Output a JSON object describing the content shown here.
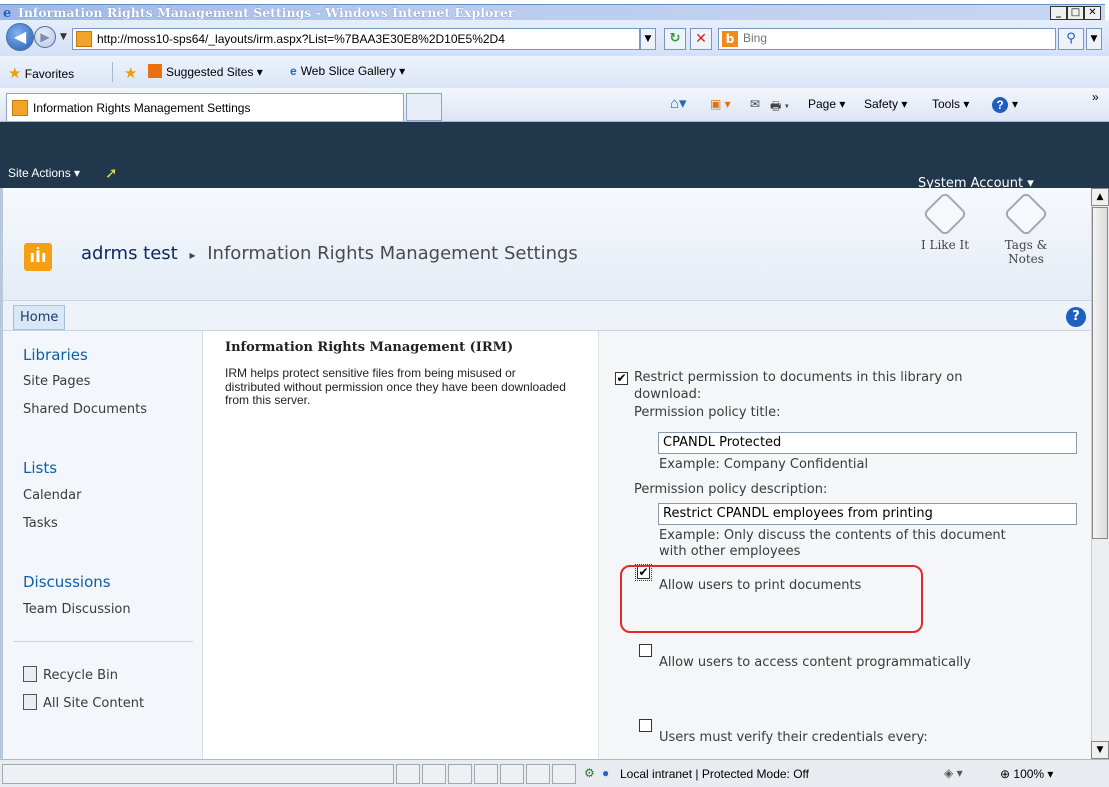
{
  "window": {
    "title": "Information Rights Management Settings - Windows Internet Explorer"
  },
  "address": {
    "url": "http://moss10-sps64/_layouts/irm.aspx?List=%7BAA3E30E8%2D10E5%2D4",
    "search_placeholder": "Bing"
  },
  "favorites_bar": {
    "favorites_label": "Favorites",
    "suggested_sites": "Suggested Sites ▾",
    "web_slice_gallery": "Web Slice Gallery ▾"
  },
  "command_bar": {
    "tab_label": "Information Rights Management Settings",
    "page_menu": "Page ▾",
    "safety_menu": "Safety ▾",
    "tools_menu": "Tools ▾",
    "overflow": "»"
  },
  "sharepoint": {
    "site_actions": "Site Actions ▾",
    "user": "System Account ▾",
    "site_name": "adrms test",
    "separator": "▸",
    "page_title": "Information Rights Management Settings",
    "i_like_it": "I Like It",
    "tags_notes_line1": "Tags &",
    "tags_notes_line2": "Notes",
    "home_tab": "Home",
    "help": "?"
  },
  "left_nav": {
    "libraries_heading": "Libraries",
    "libraries": [
      "Site Pages",
      "Shared Documents"
    ],
    "lists_heading": "Lists",
    "lists": [
      "Calendar",
      "Tasks"
    ],
    "discussions_heading": "Discussions",
    "discussions": [
      "Team Discussion"
    ],
    "recycle_bin": "Recycle Bin",
    "all_site_content": "All Site Content"
  },
  "irm": {
    "heading": "Information Rights Management (IRM)",
    "description": "IRM helps protect sensitive files from being misused or distributed without permission once they have been downloaded from this server.",
    "restrict_label_line1": "Restrict permission to documents in this library on",
    "restrict_label_line2": "download:",
    "restrict_checked": true,
    "policy_title_label": "Permission policy title:",
    "policy_title_value": "CPANDL Protected",
    "policy_title_example": "Example: Company Confidential",
    "policy_desc_label": "Permission policy description:",
    "policy_desc_value": "Restrict CPANDL employees from printing",
    "policy_desc_example_line1": "Example: Only discuss the contents of this document",
    "policy_desc_example_line2": "with other employees",
    "allow_print_label": "Allow users to print documents",
    "allow_print_checked": true,
    "allow_programmatic_label": "Allow users to access content programmatically",
    "allow_programmatic_checked": false,
    "verify_credentials_label": "Users must verify their credentials every:",
    "verify_credentials_checked": false
  },
  "status_bar": {
    "zone": "Local intranet | Protected Mode: Off",
    "zoom": "100%"
  },
  "colors": {
    "sp_header": "#21374c",
    "nav_link_blue": "#0e5fa8",
    "highlight_red": "#e02a2a",
    "ie_title_gradient": "#b8cbef"
  }
}
